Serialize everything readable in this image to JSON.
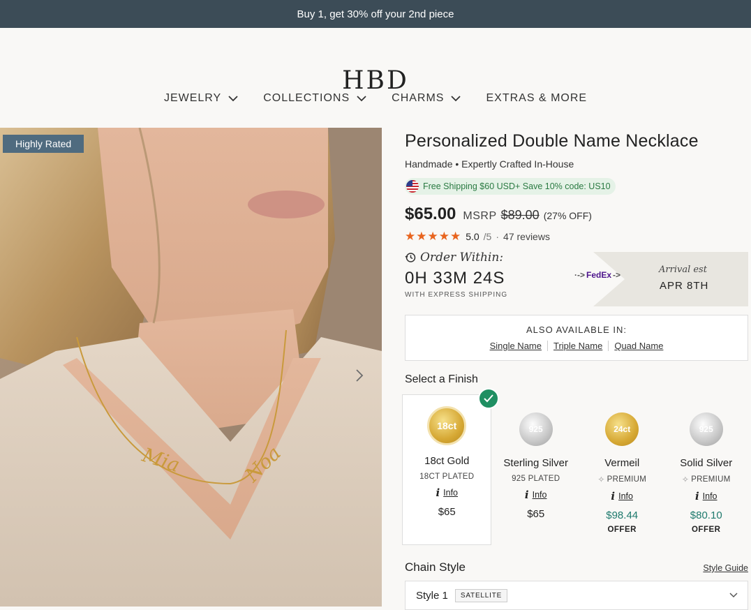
{
  "promo": {
    "text": "Buy 1, get 30% off your 2nd piece"
  },
  "header": {
    "logo": "HBD",
    "nav": [
      {
        "label": "JEWELRY"
      },
      {
        "label": "COLLECTIONS"
      },
      {
        "label": "CHARMS"
      },
      {
        "label": "EXTRAS & MORE"
      }
    ]
  },
  "hero": {
    "badge": "Highly Rated"
  },
  "product": {
    "title": "Personalized Double Name Necklace",
    "subtitle": "Handmade • Expertly Crafted In-House",
    "shipping": "Free Shipping $60 USD+ Save 10% code: US10",
    "price": "$65.00",
    "msrp_label": "MSRP",
    "msrp_value": "$89.00",
    "discount": "(27% OFF)",
    "rating": "5.0",
    "rating_scale": "/5",
    "rating_sep": "·",
    "reviews": "47 reviews",
    "stars": 5
  },
  "order": {
    "label": "Order Within:",
    "countdown": "0H 33M 24S",
    "express": "WITH EXPRESS SHIPPING",
    "carrier": "FedEx",
    "arrival_label": "Arrival est",
    "arrival_date": "APR 8TH"
  },
  "also": {
    "title": "ALSO AVAILABLE IN:",
    "links": [
      "Single Name",
      "Triple Name",
      "Quad Name"
    ]
  },
  "finish": {
    "title": "Select a Finish",
    "info_label": "Info",
    "options": [
      {
        "coin": "18ct",
        "name": "18ct Gold",
        "sub": "18CT PLATED",
        "price": "$65",
        "selected": true
      },
      {
        "coin": "925",
        "name": "Sterling Silver",
        "sub": "925 PLATED",
        "price": "$65"
      },
      {
        "coin": "24ct",
        "name": "Vermeil",
        "sub": "PREMIUM",
        "price": "$98.44",
        "offer": "OFFER"
      },
      {
        "coin": "925",
        "name": "Solid Silver",
        "sub": "PREMIUM",
        "price": "$80.10",
        "offer": "OFFER"
      }
    ]
  },
  "chain": {
    "title": "Chain Style",
    "guide": "Style Guide",
    "selected": "Style 1",
    "tag": "SATELLITE"
  },
  "colors": {
    "promo_bg": "#3c4c57",
    "badge_bg": "#4f6b7f",
    "star": "#e8641e",
    "offer_price": "#1e7a6d",
    "check": "#1f8f62"
  }
}
